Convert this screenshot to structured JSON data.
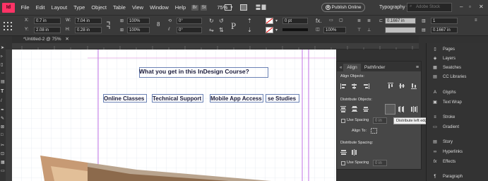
{
  "menubar": {
    "app_logo": "Id",
    "items": [
      "File",
      "Edit",
      "Layout",
      "Type",
      "Object",
      "Table",
      "View",
      "Window",
      "Help"
    ],
    "bridge_chip": "Br",
    "stock_chip": "St",
    "zoom": "75%",
    "publish_label": "Publish Online",
    "workspace": "Typography",
    "search_placeholder": "Adobe Stock"
  },
  "controlbar": {
    "x_label": "X:",
    "x_value": "0.7 in",
    "y_label": "Y:",
    "y_value": "2.08 in",
    "w_label": "W:",
    "w_value": "7.04 in",
    "h_label": "H:",
    "h_value": "0.28 in",
    "scale_x": "100%",
    "scale_y": "100%",
    "rotate": "0°",
    "shear": "0°",
    "stroke_weight": "0 pt",
    "opacity": "100%",
    "ref_width": "0.1667 in",
    "columns": "1",
    "gutter": "0.1667 in"
  },
  "document": {
    "tab_label": "*Untitled-2 @ 75%"
  },
  "canvas": {
    "heading": "What you get in this InDesign Course?",
    "items": [
      "Online Classes",
      "Technical Support",
      "Mobile App Access",
      "se Studies"
    ]
  },
  "align_panel": {
    "tabs": [
      "Align",
      "Pathfinder"
    ],
    "align_objects": "Align Objects:",
    "distribute_objects": "Distribute Objects:",
    "use_spacing": "Use Spacing",
    "spacing_value": "0 in",
    "align_to": "Align To:",
    "distribute_spacing": "Distribute Spacing:",
    "use_spacing_2": "Use Spacing",
    "spacing_value_2": "0 in"
  },
  "tooltip": "Distribute left edges",
  "right_panel": {
    "items": [
      "Pages",
      "Layers",
      "Swatches",
      "CC Libraries",
      "Glyphs",
      "Text Wrap",
      "Stroke",
      "Gradient",
      "Story",
      "Hyperlinks",
      "Effects",
      "Paragraph"
    ]
  }
}
